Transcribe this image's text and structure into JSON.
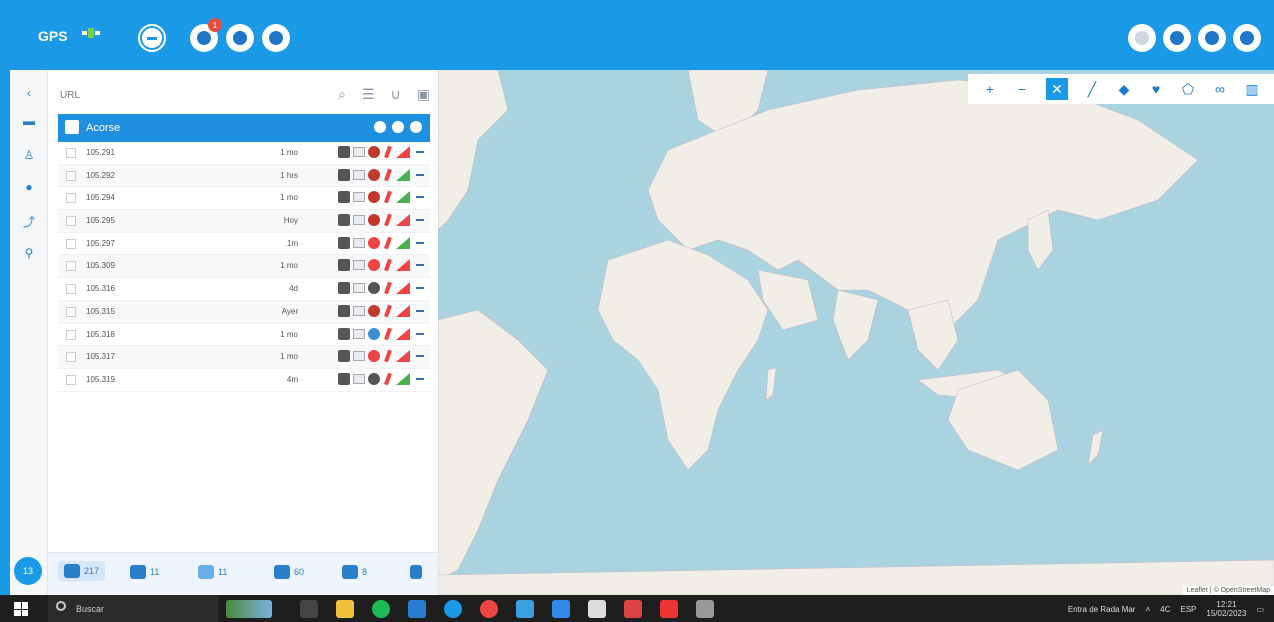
{
  "header": {
    "logo_text": "GPS",
    "notification_count": "1"
  },
  "panel": {
    "search": {
      "value": "",
      "placeholder": "URL"
    },
    "group": {
      "name": "Acorse"
    },
    "rows": [
      {
        "name": "105.291",
        "status": "1 mo"
      },
      {
        "name": "105.292",
        "status": "1 hrs"
      },
      {
        "name": "105.294",
        "status": "1 mo"
      },
      {
        "name": "105.295",
        "status": "Hoy"
      },
      {
        "name": "105.297",
        "status": "1m"
      },
      {
        "name": "105.309",
        "status": "1 mo"
      },
      {
        "name": "105.316",
        "status": "4d"
      },
      {
        "name": "105.315",
        "status": "Ayer"
      },
      {
        "name": "105.318",
        "status": "1 mo"
      },
      {
        "name": "105.317",
        "status": "1 mo"
      },
      {
        "name": "105.319",
        "status": "4m"
      }
    ],
    "footer": [
      {
        "label": "217",
        "icon": "car-icon"
      },
      {
        "label": "11",
        "icon": "cloud-icon"
      },
      {
        "label": "11",
        "icon": "route-icon"
      },
      {
        "label": "60",
        "icon": "geofence-icon"
      },
      {
        "label": "8",
        "icon": "report-icon"
      }
    ],
    "rail_badge": "13"
  },
  "map": {
    "attribution": "Leaflet | © OpenStreetMap"
  },
  "taskbar": {
    "search_placeholder": "Buscar",
    "weather": "Entra de Rada Mar",
    "temp": "4C",
    "lang": "ESP",
    "time": "12:21",
    "date": "15/02/2023"
  },
  "colors": {
    "brand_blue": "#1a9ae6",
    "group_header": "#1f8fe0",
    "map_water": "#a9d3df",
    "map_land": "#f1eee8"
  }
}
